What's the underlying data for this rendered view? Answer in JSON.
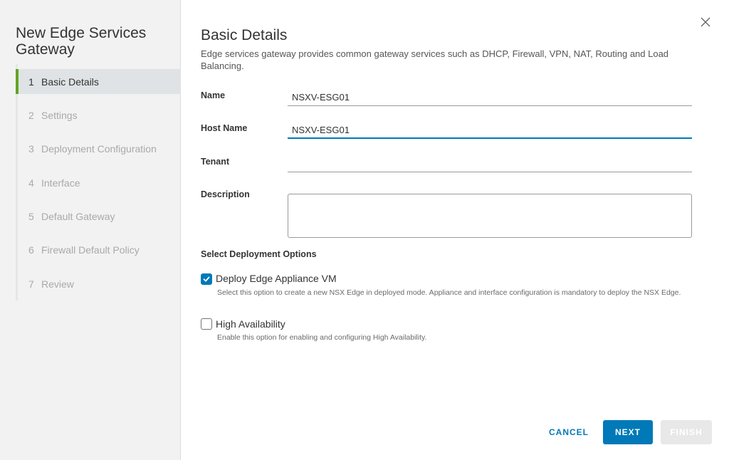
{
  "wizard": {
    "title": "New Edge Services Gateway",
    "steps": [
      {
        "num": "1",
        "label": "Basic Details"
      },
      {
        "num": "2",
        "label": "Settings"
      },
      {
        "num": "3",
        "label": "Deployment Configuration"
      },
      {
        "num": "4",
        "label": "Interface"
      },
      {
        "num": "5",
        "label": "Default Gateway"
      },
      {
        "num": "6",
        "label": "Firewall Default Policy"
      },
      {
        "num": "7",
        "label": "Review"
      }
    ],
    "active_step": 1
  },
  "page": {
    "title": "Basic Details",
    "intro": "Edge services gateway provides common gateway services such as DHCP, Firewall, VPN, NAT, Routing and Load Balancing."
  },
  "form": {
    "name_label": "Name",
    "name_value": "NSXV-ESG01",
    "host_label": "Host Name",
    "host_value": "NSXV-ESG01",
    "tenant_label": "Tenant",
    "tenant_value": "",
    "description_label": "Description",
    "description_value": ""
  },
  "deployment": {
    "title": "Select Deployment Options",
    "deploy_label": "Deploy Edge Appliance VM",
    "deploy_checked": true,
    "deploy_help": "Select this option to create a new NSX Edge in deployed mode. Appliance and interface configuration is mandatory to deploy the NSX Edge.",
    "ha_label": "High Availability",
    "ha_checked": false,
    "ha_help": "Enable this option for enabling and configuring High Availability."
  },
  "buttons": {
    "cancel": "CANCEL",
    "next": "NEXT",
    "finish": "FINISH"
  },
  "colors": {
    "accent": "#0079b8",
    "active_step_bar": "#62a420",
    "sidebar_bg": "#f2f2f2"
  },
  "icons": {
    "close": "close-icon",
    "check": "checkmark-icon"
  }
}
